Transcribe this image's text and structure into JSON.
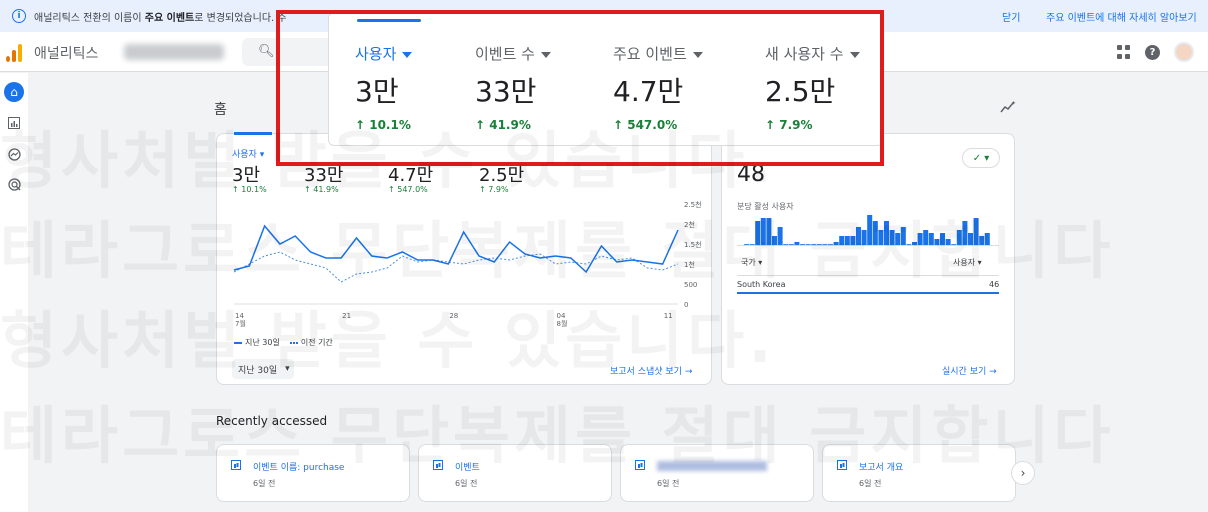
{
  "banner": {
    "pre": "애널리틱스 전환의 이름이 ",
    "bold": "주요 이벤트",
    "post": "로 변경되었습니다. 주",
    "close": "닫기",
    "learn_more": "주요 이벤트에 대해 자세히 알아보기"
  },
  "header": {
    "app_title": "애널리틱스"
  },
  "nav": {
    "icons": [
      "home-icon",
      "reports-icon",
      "explore-icon",
      "advertising-icon"
    ]
  },
  "page": {
    "title": "홈"
  },
  "overlay_metrics": [
    {
      "label": "사용자",
      "value": "3만",
      "change": "10.1%",
      "selected": true
    },
    {
      "label": "이벤트 수",
      "value": "33만",
      "change": "41.9%",
      "selected": false
    },
    {
      "label": "주요 이벤트",
      "value": "4.7만",
      "change": "547.0%",
      "selected": false
    },
    {
      "label": "새 사용자 수",
      "value": "2.5만",
      "change": "7.9%",
      "selected": false
    }
  ],
  "main_card": {
    "metric_label": "사용자",
    "metrics": [
      {
        "value": "3만",
        "change": "10.1%"
      },
      {
        "value": "33만",
        "change": "41.9%"
      },
      {
        "value": "4.7만",
        "change": "547.0%"
      },
      {
        "value": "2.5만",
        "change": "7.9%"
      }
    ],
    "legend_current": "지난 30일",
    "legend_previous": "이전 기간",
    "range_button": "지난 30일",
    "snapshot_link": "보고서 스냅샷 보기"
  },
  "chart_data": {
    "type": "line",
    "x_tick_labels": [
      "14",
      "7월",
      "21",
      "28",
      "04",
      "8월",
      "11"
    ],
    "x_ticks": [
      "14\n7월",
      "21",
      "28",
      "04\n8월",
      "11"
    ],
    "y_tick_labels": [
      "2.5천",
      "2천",
      "1.5천",
      "1천",
      "500",
      "0"
    ],
    "ylim": [
      0,
      2500
    ],
    "series": [
      {
        "name": "지난 30일",
        "values": [
          850,
          950,
          1950,
          1500,
          1700,
          1300,
          1150,
          1150,
          1650,
          1200,
          1150,
          1300,
          1100,
          1100,
          1000,
          1800,
          1200,
          1050,
          1550,
          1250,
          1150,
          1200,
          1150,
          800,
          1450,
          1050,
          1100,
          1050,
          1000,
          1850
        ]
      },
      {
        "name": "이전 기간",
        "values": [
          800,
          1000,
          1200,
          1300,
          1100,
          1000,
          900,
          550,
          750,
          800,
          900,
          1200,
          1050,
          1100,
          1050,
          1000,
          1100,
          1150,
          1100,
          1200,
          1250,
          1000,
          1050,
          1000,
          1200,
          1100,
          1150,
          900,
          850,
          1000
        ]
      }
    ]
  },
  "realtime_card": {
    "count": "48",
    "subtitle": "분당 활성 사용자",
    "col_left": "국가",
    "col_right": "사용자",
    "row_country": "South Korea",
    "row_value": "46",
    "link": "실시간 보기",
    "bars": [
      0,
      0,
      8,
      9,
      9,
      3,
      6,
      0,
      0,
      1,
      0,
      0,
      0,
      0,
      0,
      0,
      1,
      3,
      3,
      3,
      6,
      5,
      10,
      8,
      5,
      8,
      5,
      4,
      6,
      0,
      1,
      4,
      5,
      4,
      2,
      4,
      2,
      0,
      5,
      8,
      4,
      9,
      3,
      4
    ]
  },
  "recent": {
    "title": "Recently accessed",
    "cards": [
      {
        "title": "이벤트 이름: purchase",
        "sub": "6일 전"
      },
      {
        "title": "이벤트",
        "sub": "6일 전"
      },
      {
        "title": "",
        "sub": "6일 전"
      },
      {
        "title": "보고서 개요",
        "sub": "6일 전"
      }
    ]
  },
  "watermark": {
    "line1": "형사처벌 받을 수 있습니다.",
    "line2": "테라그로스 무단복제를 절대 금지합니다"
  }
}
